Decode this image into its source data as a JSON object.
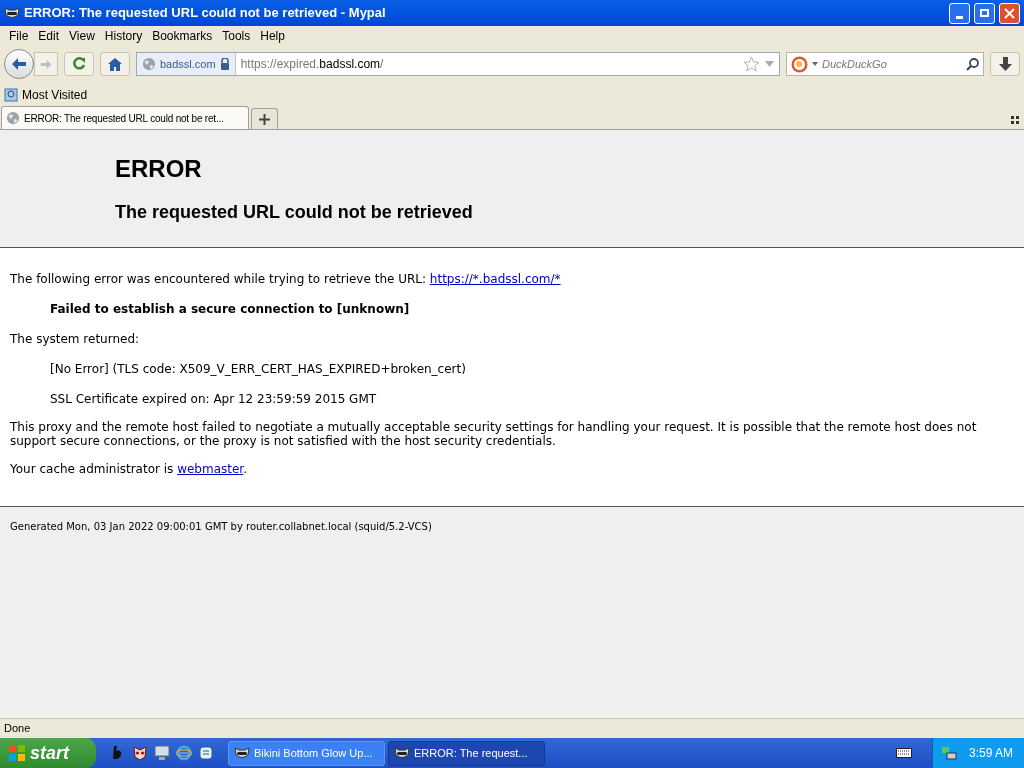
{
  "window": {
    "title": "ERROR: The requested URL could not be retrieved - Mypal"
  },
  "menu": [
    {
      "label": "File"
    },
    {
      "label": "Edit"
    },
    {
      "label": "View"
    },
    {
      "label": "History"
    },
    {
      "label": "Bookmarks"
    },
    {
      "label": "Tools"
    },
    {
      "label": "Help"
    }
  ],
  "navigation": {
    "forward_disabled": true,
    "site_identity": "badssl.com",
    "url": {
      "prefix": "https://expired.",
      "domain": "badssl.com",
      "suffix": "/"
    },
    "search": {
      "placeholder": "DuckDuckGo"
    }
  },
  "bookmarks": [
    {
      "label": "Most Visited"
    }
  ],
  "tabs": [
    {
      "label": "ERROR: The requested URL could not be ret...",
      "selected": true
    }
  ],
  "page": {
    "heading": "ERROR",
    "subheading": "The requested URL could not be retrieved",
    "intro": "The following error was encountered while trying to retrieve the URL: ",
    "intro_link": "https://*.badssl.com/*",
    "error": "Failed to establish a secure connection to [unknown]",
    "system_label": "The system returned:",
    "details": [
      "[No Error] (TLS code: X509_V_ERR_CERT_HAS_EXPIRED+broken_cert)",
      "SSL Certificate expired on: Apr 12 23:59:59 2015 GMT"
    ],
    "explanation": "This proxy and the remote host failed to negotiate a mutually acceptable security settings for handling your request. It is possible that the remote host does not support secure connections, or the proxy is not satisfied with the host security credentials.",
    "admin_prefix": "Your cache administrator is ",
    "admin_link": "webmaster",
    "admin_suffix": ".",
    "footer": "Generated Mon, 03 Jan 2022 09:00:01 GMT by router.collabnet.local (squid/5.2-VCS)"
  },
  "status_bar": "Done",
  "taskbar": {
    "start": "start",
    "tasks": [
      {
        "label": "Bikini Bottom Glow Up...",
        "selected": false
      },
      {
        "label": "ERROR: The request...",
        "selected": true
      }
    ],
    "clock": "3:59 AM"
  }
}
